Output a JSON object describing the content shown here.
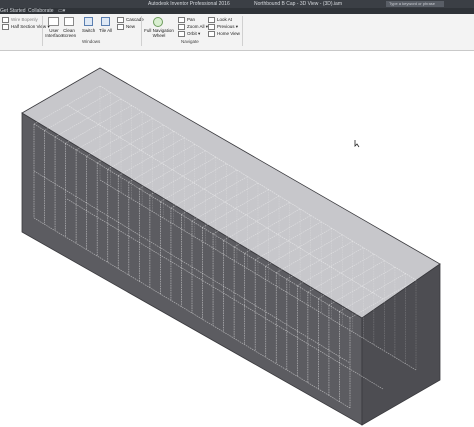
{
  "titlebar": {
    "app_title": "Autodesk Inventor Professional 2016",
    "doc_title": "Northbound B Cap - 3D View - (3D).iam",
    "search_placeholder": "Type a keyword or phrase"
  },
  "tabs": [
    "Get Started",
    "Collaborate"
  ],
  "ribbon": {
    "view_items": [
      "Wire Bopenly",
      "Half Section View"
    ],
    "windows": {
      "user_interface": "User Interface",
      "clean_screen": "Clean Screen",
      "switch": "Switch",
      "tile_all": "Tile All",
      "cascade": "Cascade",
      "new": "New",
      "label": "Windows"
    },
    "navigate": {
      "full_nav_wheel": "Full Navigation Wheel",
      "pan": "Pan",
      "zoom_all": "Zoom All",
      "orbit": "Orbit",
      "look_at": "Look At",
      "previous": "Previous",
      "home_view": "Home View",
      "label": "Navigate"
    }
  },
  "colors": {
    "titlebar_bg": "#3b3f45",
    "ribbon_bg": "#f3f3f3",
    "box_front": "#5c5c61",
    "box_top": "#b4b4b9",
    "box_end": "#4d4d52"
  },
  "icons": [
    "user-interface-icon",
    "clean-screen-icon",
    "switch-icon",
    "tile-all-icon",
    "cascade-icon",
    "new-window-icon",
    "navigation-wheel-icon",
    "pan-icon",
    "zoom-all-icon",
    "orbit-icon",
    "look-at-icon",
    "previous-icon",
    "home-view-icon",
    "mouse-cursor-icon"
  ]
}
